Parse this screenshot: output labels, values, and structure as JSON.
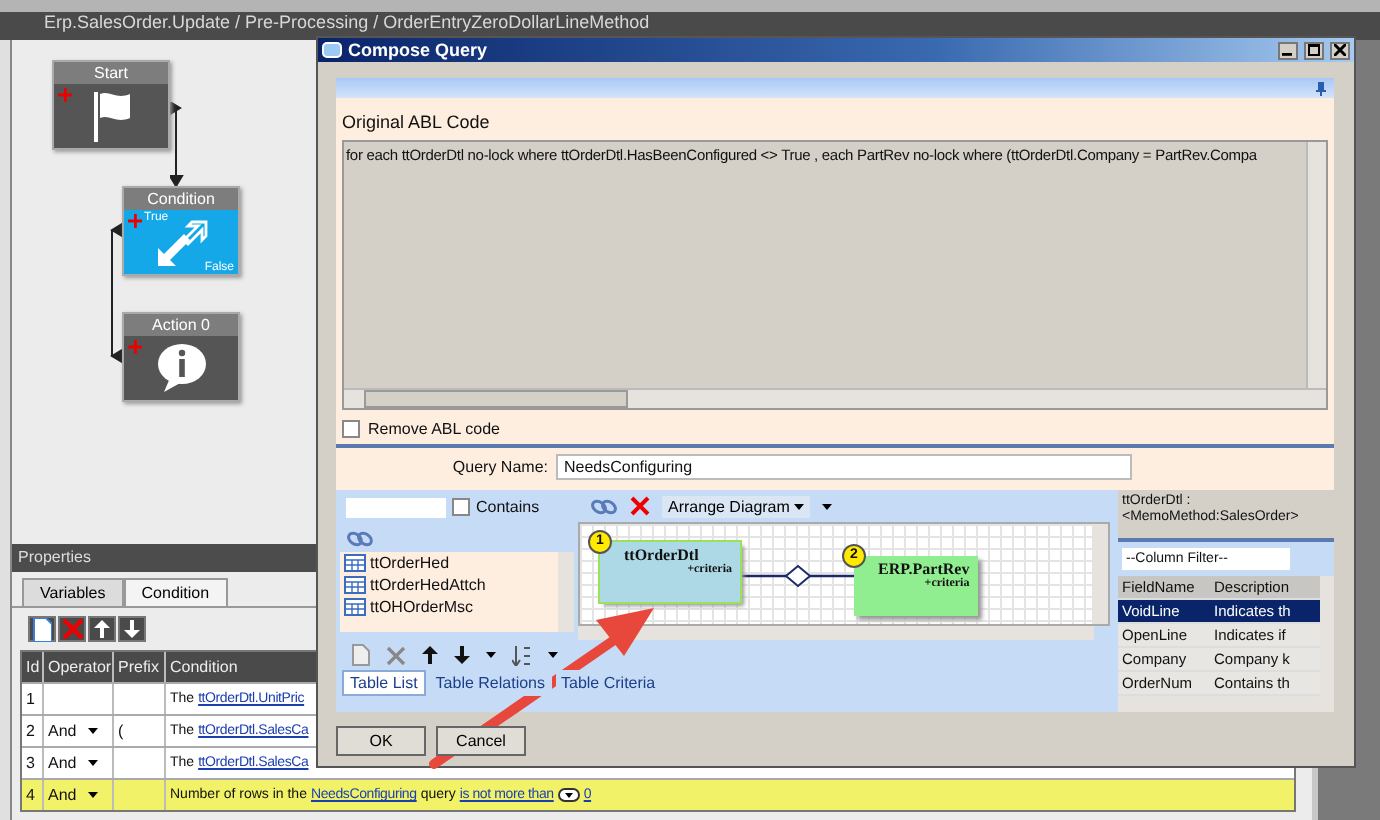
{
  "breadcrumb": "Erp.SalesOrder.Update / Pre-Processing / OrderEntryZeroDollarLineMethod",
  "flow_nodes": [
    {
      "kind": "start",
      "title": "Start"
    },
    {
      "kind": "condition",
      "title": "Condition",
      "true_label": "True",
      "false_label": "False"
    },
    {
      "kind": "action",
      "title": "Action 0"
    }
  ],
  "properties": {
    "title": "Properties",
    "tabs": [
      {
        "label": "Variables",
        "selected": false
      },
      {
        "label": "Condition",
        "selected": true
      }
    ],
    "columns": [
      "Id",
      "Operator",
      "Prefix",
      "Condition"
    ],
    "rows": [
      {
        "id": "1",
        "highlighted": false,
        "parts": [
          {
            "kind": "text",
            "text": "The"
          },
          {
            "kind": "link",
            "text": "ttOrderDtl.UnitPric"
          }
        ]
      },
      {
        "id": "2",
        "operator": "And",
        "prefix": "(",
        "highlighted": false,
        "parts": [
          {
            "kind": "text",
            "text": "The"
          },
          {
            "kind": "link",
            "text": "ttOrderDtl.SalesCa"
          }
        ]
      },
      {
        "id": "3",
        "operator": "And",
        "highlighted": false,
        "parts": [
          {
            "kind": "text",
            "text": "The"
          },
          {
            "kind": "link",
            "text": "ttOrderDtl.SalesCa"
          }
        ]
      },
      {
        "id": "4",
        "operator": "And",
        "highlighted": true,
        "parts": [
          {
            "kind": "text",
            "text": "Number of rows in the"
          },
          {
            "kind": "link",
            "text": "NeedsConfiguring"
          },
          {
            "kind": "text",
            "text": "query"
          },
          {
            "kind": "link",
            "text": "is not more than"
          },
          {
            "kind": "dropdown"
          },
          {
            "kind": "link",
            "text": "0"
          }
        ]
      }
    ]
  },
  "dialog": {
    "title": "Compose Query",
    "abl_label": "Original ABL Code",
    "abl_code": "for each ttOrderDtl no-lock  where  ttOrderDtl.HasBeenConfigured <> True  ,  each PartRev no-lock  where (ttOrderDtl.Company = PartRev.Compa",
    "remove_abl": {
      "label": "Remove ABL code",
      "checked": false
    },
    "query_name": {
      "label": "Query Name:",
      "value": "NeedsConfiguring"
    },
    "contains": {
      "label": "Contains",
      "checked": false
    },
    "tables": [
      "ttOrderHed",
      "ttOrderHedAttch",
      "ttOHOrderMsc"
    ],
    "arrange_label": "Arrange Diagram",
    "diagram_nodes": [
      {
        "number": "1",
        "name": "ttOrderDtl",
        "criteria": "+criteria",
        "selected": true,
        "color": "#add8e6"
      },
      {
        "number": "2",
        "name": "ERP.PartRev",
        "criteria": "+criteria",
        "selected": false,
        "color": "#90ee90"
      }
    ],
    "bottom_tabs": [
      {
        "label": "Table List",
        "selected": true
      },
      {
        "label": "Table Relations",
        "selected": false
      },
      {
        "label": "Table Criteria",
        "selected": false
      }
    ],
    "table_info": "ttOrderDtl : <MemoMethod:SalesOrder>",
    "column_filter": "--Column Filter--",
    "field_columns": [
      "FieldName",
      "Description"
    ],
    "fields": [
      {
        "name": "VoidLine",
        "description": "Indicates th",
        "selected": true
      },
      {
        "name": "OpenLine",
        "description": "Indicates if",
        "selected": false
      },
      {
        "name": "Company",
        "description": "Company k",
        "selected": false
      },
      {
        "name": "OrderNum",
        "description": "Contains th",
        "selected": false
      }
    ],
    "buttons": [
      "OK",
      "Cancel"
    ]
  }
}
